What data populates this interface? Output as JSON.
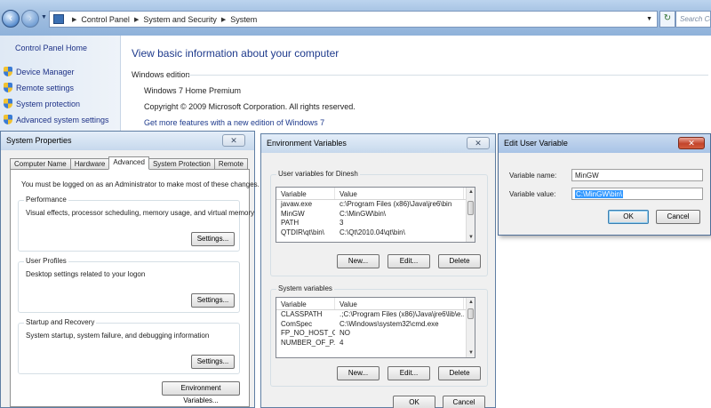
{
  "explorer": {
    "breadcrumbs": [
      "Control Panel",
      "System and Security",
      "System"
    ],
    "search_placeholder": "Search Co"
  },
  "left_pane": {
    "home": "Control Panel Home",
    "links": [
      "Device Manager",
      "Remote settings",
      "System protection",
      "Advanced system settings"
    ]
  },
  "main": {
    "heading": "View basic information about your computer",
    "section": "Windows edition",
    "edition": "Windows 7 Home Premium",
    "copyright": "Copyright © 2009 Microsoft Corporation.  All rights reserved.",
    "more_features": "Get more features with a new edition of Windows 7"
  },
  "system_properties": {
    "title": "System Properties",
    "tabs": [
      "Computer Name",
      "Hardware",
      "Advanced",
      "System Protection",
      "Remote"
    ],
    "active_tab": "Advanced",
    "admin_note": "You must be logged on as an Administrator to make most of these changes.",
    "performance": {
      "label": "Performance",
      "desc": "Visual effects, processor scheduling, memory usage, and virtual memory",
      "button": "Settings..."
    },
    "user_profiles": {
      "label": "User Profiles",
      "desc": "Desktop settings related to your logon",
      "button": "Settings..."
    },
    "startup": {
      "label": "Startup and Recovery",
      "desc": "System startup, system failure, and debugging information",
      "button": "Settings..."
    },
    "env_button": "Environment Variables..."
  },
  "env_vars": {
    "title": "Environment Variables",
    "user_group": "User variables for Dinesh",
    "system_group": "System variables",
    "col_variable": "Variable",
    "col_value": "Value",
    "user_rows": [
      {
        "variable": "javaw.exe",
        "value": "c:\\Program Files (x86)\\Java\\jre6\\bin"
      },
      {
        "variable": "MinGW",
        "value": "C:\\MinGW\\bin\\"
      },
      {
        "variable": "PATH",
        "value": "3"
      },
      {
        "variable": "QTDIR\\qt\\bin\\",
        "value": "C:\\Qt\\2010.04\\qt\\bin\\"
      }
    ],
    "system_rows": [
      {
        "variable": "CLASSPATH",
        "value": ".;C:\\Program Files (x86)\\Java\\jre6\\lib\\e..."
      },
      {
        "variable": "ComSpec",
        "value": "C:\\Windows\\system32\\cmd.exe"
      },
      {
        "variable": "FP_NO_HOST_C...",
        "value": "NO"
      },
      {
        "variable": "NUMBER_OF_P...",
        "value": "4"
      }
    ],
    "new": "New...",
    "edit": "Edit...",
    "delete": "Delete",
    "ok": "OK",
    "cancel": "Cancel"
  },
  "edit_user_var": {
    "title": "Edit User Variable",
    "name_label": "Variable name:",
    "name_value": "MinGW",
    "value_label": "Variable value:",
    "value_value": "C:\\MinGW\\bin\\",
    "ok": "OK",
    "cancel": "Cancel"
  }
}
